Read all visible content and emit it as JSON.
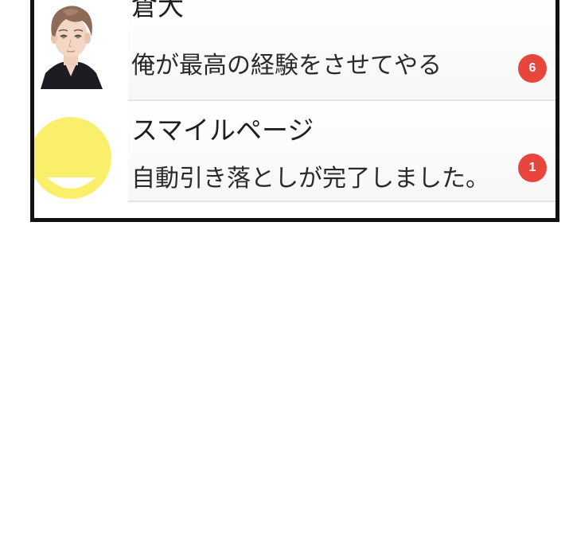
{
  "conversations": [
    {
      "name": "倉大",
      "message": "俺が最高の経験をさせてやる",
      "unread": "6",
      "avatar": "person-avatar-icon"
    },
    {
      "name": "スマイルページ",
      "message": "自動引き落としが完了しました。",
      "unread": "1",
      "avatar": "smile-face-icon"
    }
  ],
  "colors": {
    "badge": "#e8453c",
    "smile_face": "#f9ef6a",
    "frame": "#111111"
  }
}
